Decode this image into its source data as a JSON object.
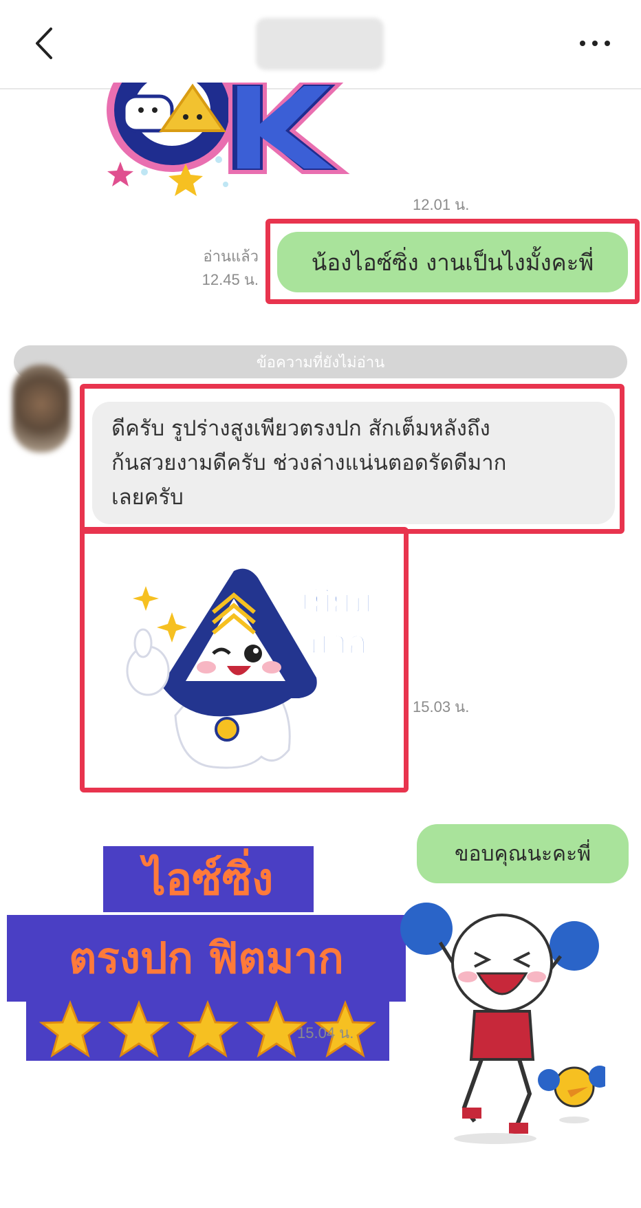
{
  "header": {
    "back_label": "Back",
    "more_label": "More"
  },
  "messages": {
    "ok_sticker_time": "12.01 น.",
    "out_1": {
      "text": "น้องไอซ์ซิ่ง งานเป็นไงมั้งคะพี่",
      "read": "อ่านแล้ว",
      "time": "12.45 น."
    },
    "unread_divider": "ข้อความที่ยังไม่อ่าน",
    "in_1": {
      "line1": "ดีครับ รูปร่างสูงเพียวตรงปก สักเต็มหลังถึง",
      "line2": "ก้นสวยงามดีครับ ช่วงล่างแน่นตอดรัดดีมาก",
      "line3": "เลยครับ"
    },
    "sticker_in_text": [
      "เยี่ยม",
      "มาก"
    ],
    "sticker_in_time": "15.03 น.",
    "out_2": {
      "text": "ขอบคุณนะคะพี่"
    },
    "sticker_out_time": "15.04 น."
  },
  "promo": {
    "line1": "ไอซ์ซิ่ง",
    "line2": "ตรงปก ฟิตมาก",
    "stars": 5
  },
  "colors": {
    "outgoing_bubble": "#a9e39b",
    "incoming_bubble": "#eeeeee",
    "highlight_border": "#e8344e",
    "promo_bg": "#4a3fc4",
    "promo_text": "#ff7a3a"
  }
}
